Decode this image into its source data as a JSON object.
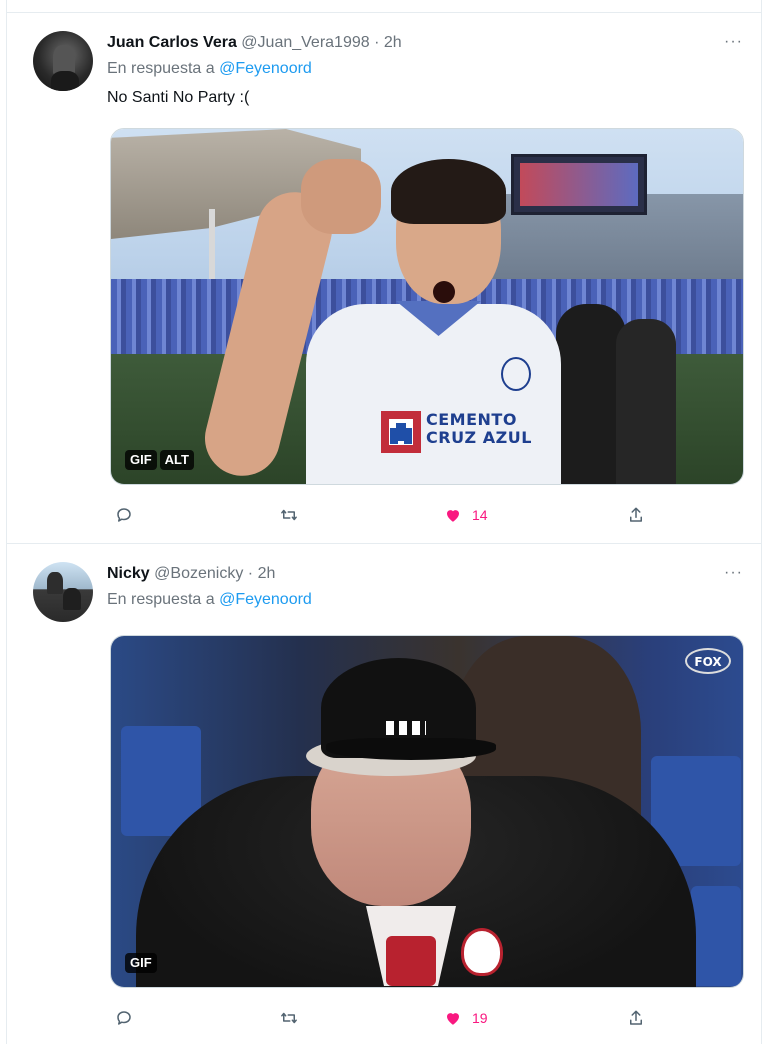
{
  "tweets": [
    {
      "name": "Juan Carlos Vera",
      "handle": "@Juan_Vera1998",
      "separator": "·",
      "time": "2h",
      "more": "···",
      "reply_prefix": "En respuesta a",
      "reply_to": "@Feyenoord",
      "text": "No Santi No Party :(",
      "media": {
        "sponsor_line1": "CEMENTO",
        "sponsor_line2": "CRUZ AZUL",
        "badges": [
          "GIF",
          "ALT"
        ]
      },
      "likes": "14"
    },
    {
      "name": "Nicky",
      "handle": "@Bozenicky",
      "separator": "·",
      "time": "2h",
      "more": "···",
      "reply_prefix": "En respuesta a",
      "reply_to": "@Feyenoord",
      "text": "",
      "media": {
        "watermark": "FOX",
        "badges": [
          "GIF"
        ]
      },
      "likes": "19"
    }
  ],
  "colors": {
    "accent_link": "#1d9bf0",
    "like_active": "#f91880",
    "muted_text": "#6a737b"
  },
  "icons": [
    "reply-icon",
    "retweet-icon",
    "heart-icon",
    "share-icon",
    "more-icon"
  ]
}
